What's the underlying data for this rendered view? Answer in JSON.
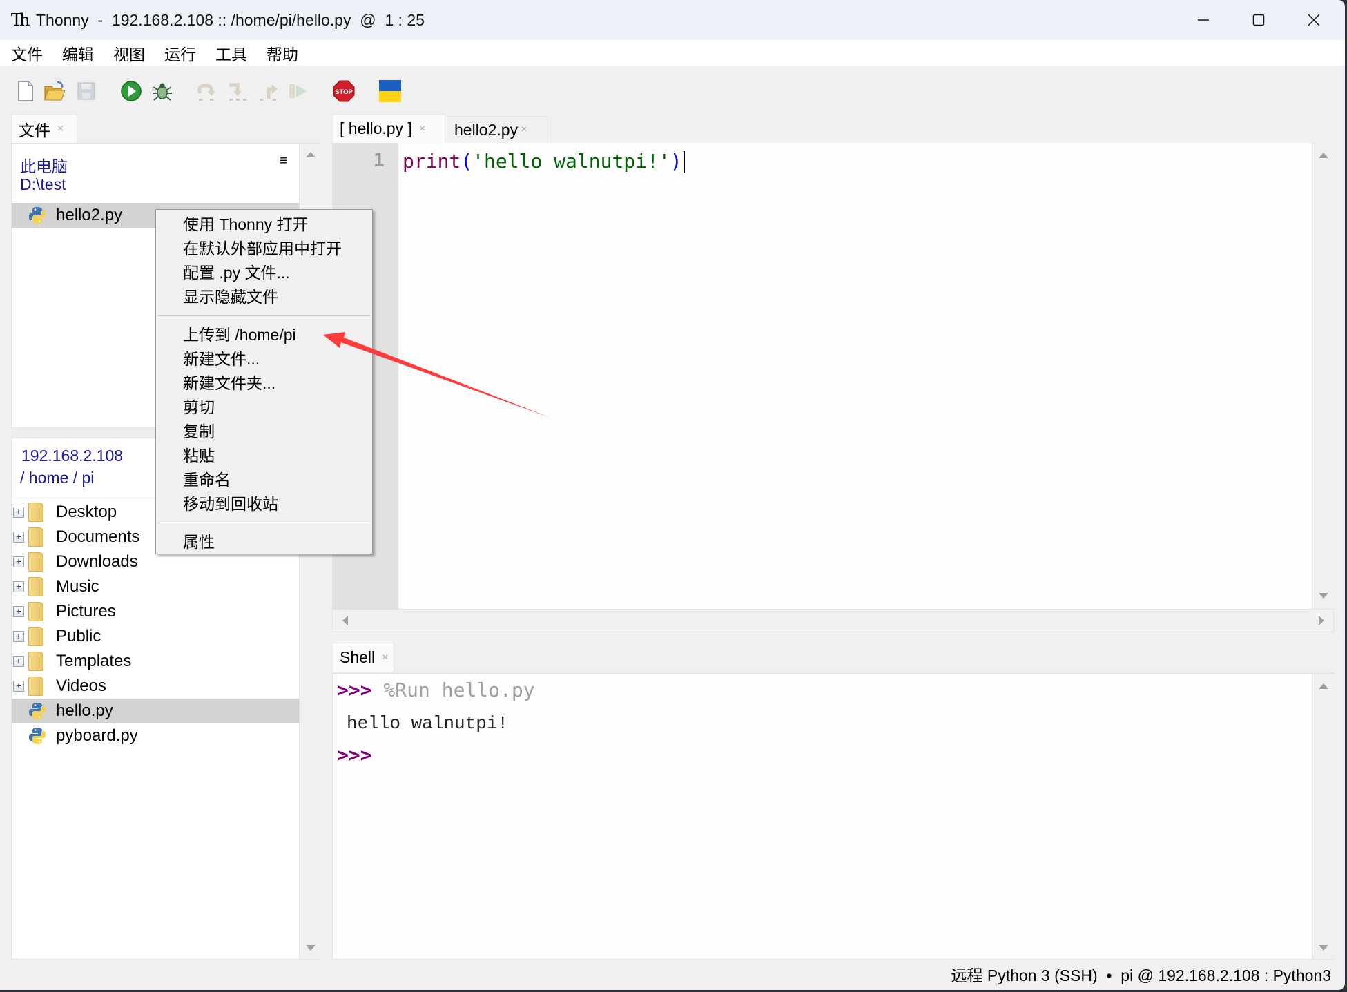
{
  "window": {
    "title": "Thonny  -  192.168.2.108 :: /home/pi/hello.py  @  1 : 25",
    "logo_text": "Th",
    "controls": {
      "minimize": "—",
      "maximize": "☐",
      "close": "✕"
    }
  },
  "menubar": [
    "文件",
    "编辑",
    "视图",
    "运行",
    "工具",
    "帮助"
  ],
  "toolbar": [
    {
      "name": "new-file",
      "icon": "new-file-icon",
      "enabled": true
    },
    {
      "name": "open-file",
      "icon": "open-folder-icon",
      "enabled": true
    },
    {
      "name": "save-file",
      "icon": "save-icon",
      "enabled": false
    },
    {
      "name": "run",
      "icon": "run-icon",
      "enabled": true
    },
    {
      "name": "debug",
      "icon": "bug-icon",
      "enabled": true
    },
    {
      "name": "step-over",
      "icon": "step-over-icon",
      "enabled": false
    },
    {
      "name": "step-into",
      "icon": "step-into-icon",
      "enabled": false
    },
    {
      "name": "step-out",
      "icon": "step-out-icon",
      "enabled": false
    },
    {
      "name": "resume",
      "icon": "resume-icon",
      "enabled": false
    },
    {
      "name": "stop",
      "icon": "stop-icon",
      "label": "STOP",
      "enabled": true
    },
    {
      "name": "ukraine-support",
      "icon": "ukraine-flag-icon",
      "enabled": true
    }
  ],
  "files_panel": {
    "tab_label": "文件",
    "tab_close": "×",
    "local": {
      "line1": "此电脑",
      "line2": "D:\\test",
      "menu_icon": "≡",
      "items": [
        {
          "name": "hello2.py",
          "type": "python",
          "selected": true
        }
      ]
    },
    "remote": {
      "line1": "192.168.2.108",
      "line2": "/ home / pi",
      "items": [
        {
          "name": "Desktop",
          "type": "folder",
          "expander": "+"
        },
        {
          "name": "Documents",
          "type": "folder",
          "expander": "+"
        },
        {
          "name": "Downloads",
          "type": "folder",
          "expander": "+"
        },
        {
          "name": "Music",
          "type": "folder",
          "expander": "+"
        },
        {
          "name": "Pictures",
          "type": "folder",
          "expander": "+"
        },
        {
          "name": "Public",
          "type": "folder",
          "expander": "+"
        },
        {
          "name": "Templates",
          "type": "folder",
          "expander": "+"
        },
        {
          "name": "Videos",
          "type": "folder",
          "expander": "+"
        },
        {
          "name": "hello.py",
          "type": "python",
          "selected": true
        },
        {
          "name": "pyboard.py",
          "type": "python",
          "selected": false
        }
      ]
    }
  },
  "context_menu": {
    "groups": [
      [
        "使用 Thonny 打开",
        "在默认外部应用中打开",
        "配置 .py 文件...",
        "显示隐藏文件"
      ],
      [
        "上传到 /home/pi",
        "新建文件...",
        "新建文件夹...",
        "剪切",
        "复制",
        "粘贴",
        "重命名",
        "移动到回收站"
      ],
      [
        "属性"
      ]
    ],
    "highlighted_by_annotation": "上传到 /home/pi"
  },
  "editor": {
    "tabs": [
      {
        "label": "[ hello.py ]",
        "close": "×",
        "active": true
      },
      {
        "label": "hello2.py",
        "close": "×",
        "active": false
      }
    ],
    "lines": [
      {
        "number": "1",
        "tokens": [
          {
            "text": "print",
            "color": "#7f0055"
          },
          {
            "text": "(",
            "color": "#0000ff"
          },
          {
            "text": "'hello walnutpi!'",
            "color": "#006400"
          },
          {
            "text": ")",
            "color": "#0000ff"
          }
        ]
      }
    ]
  },
  "shell": {
    "tab_label": "Shell",
    "tab_close": "×",
    "prompt": ">>>",
    "command": "%Run hello.py",
    "output": "hello walnutpi!",
    "colors": {
      "prompt": "#800080",
      "command": "#a0a0a0",
      "output": "#222222"
    }
  },
  "statusbar": {
    "text": "远程 Python 3 (SSH)  •  pi @ 192.168.2.108 : Python3"
  },
  "annotation": {
    "type": "red-arrow",
    "color": "#ff3b3b",
    "points_to": "上传到 /home/pi"
  }
}
